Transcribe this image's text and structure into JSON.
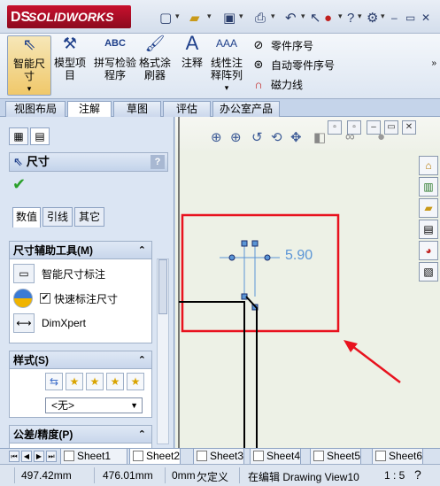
{
  "app": {
    "logo_text": "SOLIDWORKS",
    "logo_mark": "DS"
  },
  "quick_access": [
    {
      "icon": "new-document-icon"
    },
    {
      "icon": "open-folder-icon"
    },
    {
      "icon": "save-icon"
    },
    {
      "icon": "print-icon"
    },
    {
      "icon": "undo-icon"
    },
    {
      "icon": "select-arrow-icon"
    },
    {
      "icon": "rebuild-traffic-light-icon"
    },
    {
      "icon": "help-icon"
    },
    {
      "icon": "options-icon"
    }
  ],
  "window_controls": {
    "minimize": "–",
    "restore": "▭",
    "close": "✕"
  },
  "ribbon": {
    "smart_dimension": "智能尺寸",
    "model_items": "模型项目",
    "spell_checker": "拼写检验程序",
    "format_painter": "格式涂刷器",
    "note": "注释",
    "linear_pattern": "线性注释阵列",
    "balloon": "零件序号",
    "auto_balloon": "自动零件序号",
    "magnetic_line": "磁力线"
  },
  "command_tabs": [
    "视图布局",
    "注解",
    "草图",
    "评估",
    "办公室产品"
  ],
  "active_command_tab": "注解",
  "property_manager": {
    "title": "尺寸",
    "help": "?",
    "ok_mark": "✔",
    "subtabs": [
      "数值",
      "引线",
      "其它"
    ],
    "dim_assist": {
      "header": "尺寸辅助工具(M)",
      "smart_dim_label": "智能尺寸标注",
      "quick_dim_label": "快速标注尺寸",
      "quick_dim_checked": true,
      "dimxpert_label": "DimXpert"
    },
    "style": {
      "header": "样式(S)",
      "selected": "<无>"
    },
    "tolerance": {
      "header": "公差/精度(P)"
    }
  },
  "graphics": {
    "dimension_value": "5.90",
    "highlight_color": "#e8121e",
    "arrow_color": "#e8121e",
    "dimension_color": "#5a95d6"
  },
  "sheet_tabs": [
    "Sheet1",
    "Sheet2",
    "Sheet3",
    "Sheet4",
    "Sheet5",
    "Sheet6"
  ],
  "active_sheet": "Sheet2",
  "status": {
    "x": "497.42mm",
    "y": "476.01mm",
    "z": "0mm",
    "state": "欠定义",
    "editing": "在编辑 Drawing View10",
    "scale": "1 : 5"
  }
}
